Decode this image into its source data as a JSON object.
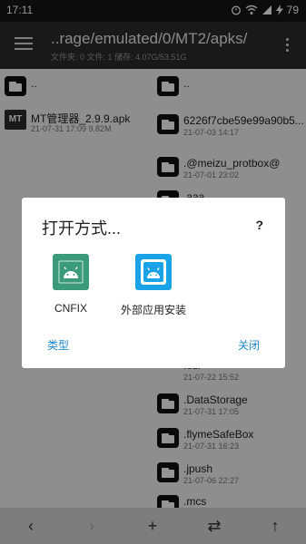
{
  "status": {
    "time": "17:11",
    "battery": "79"
  },
  "toolbar": {
    "path": "..rage/emulated/0/MT2/apks/",
    "info": "文件夹: 0  文件: 1  储存: 4.07G/53.51G"
  },
  "left_pane": {
    "items": [
      {
        "name": "..",
        "meta": "",
        "type": "folder"
      },
      {
        "name": "MT管理器_2.9.9.apk",
        "meta": "21-07-31 17:09  9.82M",
        "type": "apk",
        "icon_text": "MT"
      }
    ]
  },
  "right_pane": {
    "items": [
      {
        "name": "..",
        "meta": ""
      },
      {
        "name": "6226f7cbe59e99a90b5...",
        "meta": "21-07-03 14:17"
      },
      {
        "name": ".@meizu_protbox@",
        "meta": "21-07-01 23:02"
      },
      {
        "name": ".aaa",
        "meta": ""
      },
      {
        "name": ".cdi",
        "meta": "21-07-22 15:52"
      },
      {
        "name": ".DataStorage",
        "meta": "21-07-31 17:05"
      },
      {
        "name": ".flymeSafeBox",
        "meta": "21-07-31 16:23"
      },
      {
        "name": ".jpush",
        "meta": "21-07-06 22:27"
      },
      {
        "name": ".mcs",
        "meta": ""
      }
    ]
  },
  "dialog": {
    "title": "打开方式...",
    "help": "?",
    "choices": [
      {
        "label": "CNFIX",
        "icon": "android-icon",
        "color": "#3a9a7a"
      },
      {
        "label": "外部应用安装",
        "icon": "android-icon",
        "color": "#1aa3e6"
      }
    ],
    "type_button": "类型",
    "close_button": "关闭"
  },
  "bottombar": {
    "back": "‹",
    "forward": "›",
    "add": "+",
    "swap": "⇄",
    "up": "↑"
  }
}
